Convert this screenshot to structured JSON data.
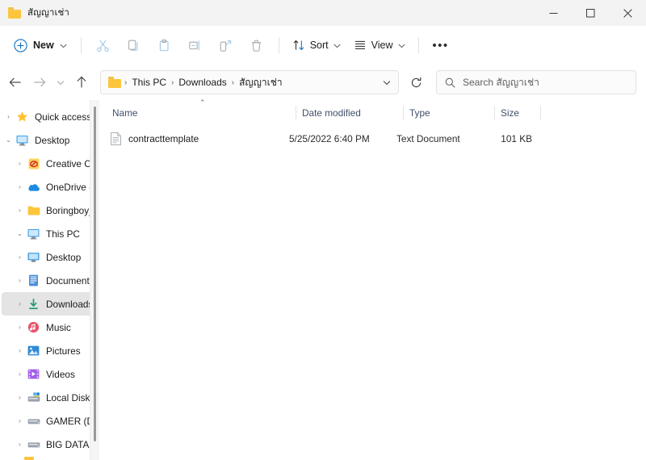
{
  "window": {
    "title": "สัญญาเช่า",
    "folder_icon": "folder-icon",
    "controls": {
      "minimize": "minimize-button",
      "maximize": "maximize-button",
      "close": "close-button"
    }
  },
  "toolbar": {
    "new_label": "New",
    "new_icon": "plus-circle-icon",
    "cut_icon": "scissors-icon",
    "copy_icon": "copy-icon",
    "paste_icon": "paste-icon",
    "rename_icon": "rename-icon",
    "share_icon": "share-icon",
    "delete_icon": "trash-icon",
    "sort_label": "Sort",
    "sort_icon": "sort-arrows-icon",
    "view_label": "View",
    "view_icon": "view-lines-icon",
    "more_label": "•••"
  },
  "addressbar": {
    "back_icon": "arrow-left-icon",
    "forward_icon": "arrow-right-icon",
    "recent_icon": "chevron-down-icon",
    "up_icon": "arrow-up-icon",
    "folder_icon": "folder-icon",
    "crumbs": [
      "This PC",
      "Downloads",
      "สัญญาเช่า"
    ],
    "separator": "›",
    "dropdown_icon": "chevron-down-icon",
    "refresh_icon": "refresh-icon"
  },
  "search": {
    "icon": "search-icon",
    "placeholder": "Search สัญญาเช่า",
    "value": ""
  },
  "sidebar": {
    "items": [
      {
        "label": "Quick access",
        "icon": "star-icon",
        "level": 1,
        "expander": "›",
        "selected": false
      },
      {
        "label": "Desktop",
        "icon": "monitor-icon",
        "level": 1,
        "expander": "⌄",
        "selected": false
      },
      {
        "label": "Creative Cloud",
        "icon": "creative-cloud-icon",
        "level": 2,
        "expander": "›",
        "selected": false
      },
      {
        "label": "OneDrive - Pers",
        "icon": "onedrive-icon",
        "level": 2,
        "expander": "›",
        "selected": false
      },
      {
        "label": "Boringboy_",
        "icon": "folder-icon",
        "level": 2,
        "expander": "›",
        "selected": false
      },
      {
        "label": "This PC",
        "icon": "monitor-icon",
        "level": 2,
        "expander": "⌄",
        "selected": false
      },
      {
        "label": "Desktop",
        "icon": "desktop-folder-icon",
        "level": 3,
        "expander": "›",
        "selected": false
      },
      {
        "label": "Documents",
        "icon": "documents-icon",
        "level": 3,
        "expander": "›",
        "selected": false
      },
      {
        "label": "Downloads",
        "icon": "downloads-icon",
        "level": 3,
        "expander": "›",
        "selected": true
      },
      {
        "label": "Music",
        "icon": "music-icon",
        "level": 3,
        "expander": "›",
        "selected": false
      },
      {
        "label": "Pictures",
        "icon": "pictures-icon",
        "level": 3,
        "expander": "›",
        "selected": false
      },
      {
        "label": "Videos",
        "icon": "videos-icon",
        "level": 3,
        "expander": "›",
        "selected": false
      },
      {
        "label": "Local Disk (C:",
        "icon": "system-drive-icon",
        "level": 3,
        "expander": "›",
        "selected": false
      },
      {
        "label": "GAMER (D:)",
        "icon": "drive-icon",
        "level": 3,
        "expander": "›",
        "selected": false
      },
      {
        "label": "BIG DATA (E:)",
        "icon": "drive-icon",
        "level": 3,
        "expander": "›",
        "selected": false
      }
    ]
  },
  "filelist": {
    "columns": [
      {
        "label": "Name",
        "sorted": "asc",
        "sort_caret": "⌃"
      },
      {
        "label": "Date modified",
        "sorted": ""
      },
      {
        "label": "Type",
        "sorted": ""
      },
      {
        "label": "Size",
        "sorted": ""
      }
    ],
    "rows": [
      {
        "icon": "text-document-icon",
        "name": "contracttemplate",
        "date_modified": "5/25/2022 6:40 PM",
        "type": "Text Document",
        "size": "101 KB"
      }
    ]
  },
  "colors": {
    "folder_yellow": "#fcc53d",
    "accent_blue": "#0078d4",
    "selection_gray": "#e4e4e4",
    "header_text": "#414f6b",
    "titlebar_bg": "#f3f3f3"
  }
}
